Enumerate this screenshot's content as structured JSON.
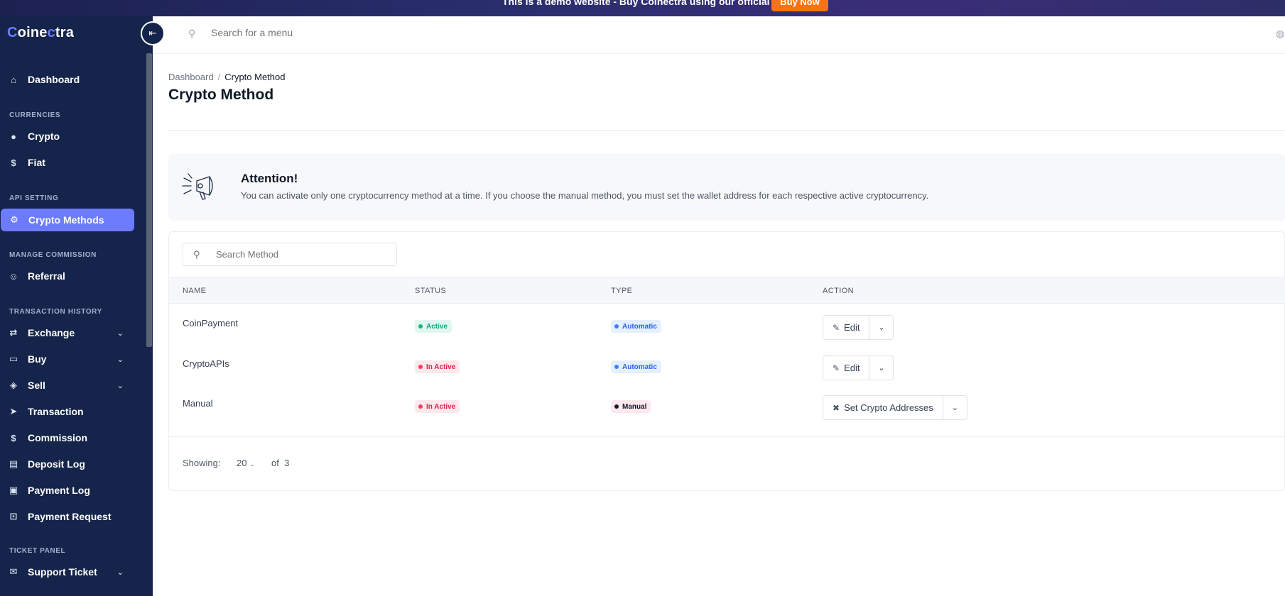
{
  "banner": {
    "text": "This is a demo website - Buy Coinectra using our official link.",
    "button": "Buy Now"
  },
  "brand": {
    "logo_first": "C",
    "logo_mid": "oine",
    "logo_c2": "c",
    "logo_end": "tra"
  },
  "topbar": {
    "search_placeholder": "Search for a menu"
  },
  "sidebar": {
    "dashboard": "Dashboard",
    "sections": {
      "currencies": "CURRENCIES",
      "api_setting": "API SETTING",
      "manage_commission": "MANAGE COMMISSION",
      "transaction_history": "TRANSACTION HISTORY",
      "ticket_panel": "TICKET PANEL"
    },
    "items": {
      "crypto": "Crypto",
      "fiat": "Fiat",
      "crypto_methods": "Crypto Methods",
      "referral": "Referral",
      "exchange": "Exchange",
      "buy": "Buy",
      "sell": "Sell",
      "transaction": "Transaction",
      "commission": "Commission",
      "deposit_log": "Deposit Log",
      "payment_log": "Payment Log",
      "payment_request": "Payment Request",
      "support_ticket": "Support Ticket"
    },
    "active_accent": "#6d7cff"
  },
  "breadcrumb": {
    "home": "Dashboard",
    "sep": "/",
    "current": "Crypto Method"
  },
  "page": {
    "title": "Crypto Method"
  },
  "alert": {
    "title": "Attention!",
    "text": "You can activate only one cryptocurrency method at a time. If you choose the manual method, you must set the wallet address for each respective active cryptocurrency."
  },
  "table": {
    "search_placeholder": "Search Method",
    "headers": {
      "name": "NAME",
      "status": "STATUS",
      "type": "TYPE",
      "action": "ACTION"
    },
    "rows": [
      {
        "name": "CoinPayment",
        "status": "Active",
        "type": "Automatic",
        "action": "Edit"
      },
      {
        "name": "CryptoAPIs",
        "status": "In Active",
        "type": "Automatic",
        "action": "Edit"
      },
      {
        "name": "Manual",
        "status": "In Active",
        "type": "Manual",
        "action": "Set Crypto Addresses"
      }
    ],
    "footer": {
      "showing_label": "Showing:",
      "per_page": "20",
      "of_label": "of",
      "total": "3"
    }
  }
}
